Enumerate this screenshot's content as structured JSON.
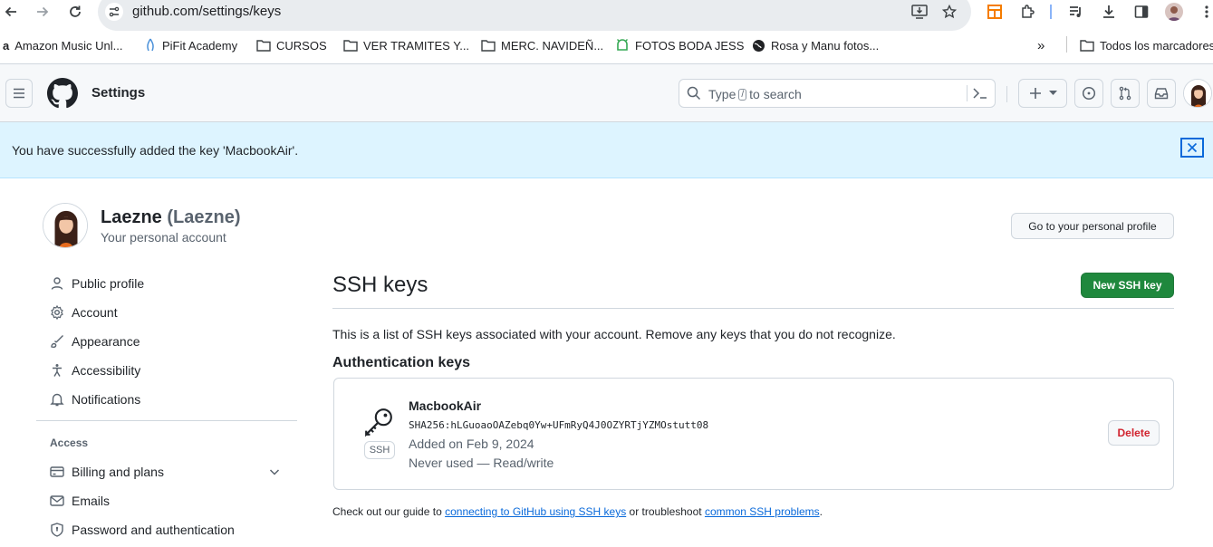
{
  "browser": {
    "url": "github.com/settings/keys",
    "bookmarks": [
      {
        "label": "Amazon Music Unl...",
        "icon": "amazon-icon"
      },
      {
        "label": "PiFit Academy",
        "icon": "pifit-icon"
      },
      {
        "label": "CURSOS",
        "icon": "folder-icon"
      },
      {
        "label": "VER TRAMITES Y...",
        "icon": "folder-icon"
      },
      {
        "label": "MERC. NAVIDEÑ...",
        "icon": "folder-icon"
      },
      {
        "label": "FOTOS BODA JESS",
        "icon": "android-icon"
      },
      {
        "label": "Rosa y Manu fotos...",
        "icon": "globe-icon"
      }
    ],
    "overflow_label": "»",
    "all_bookmarks_label": "Todos los marcadores"
  },
  "header": {
    "title": "Settings",
    "search_prefix": "Type",
    "search_key": "/",
    "search_suffix": "to search"
  },
  "flash": {
    "message": "You have successfully added the key 'MacbookAir'."
  },
  "profile": {
    "name": "Laezne",
    "login": "(Laezne)",
    "subtitle": "Your personal account",
    "profile_button": "Go to your personal profile"
  },
  "sidebar": {
    "items": [
      {
        "label": "Public profile",
        "icon": "person-icon"
      },
      {
        "label": "Account",
        "icon": "gear-icon"
      },
      {
        "label": "Appearance",
        "icon": "paintbrush-icon"
      },
      {
        "label": "Accessibility",
        "icon": "accessibility-icon"
      },
      {
        "label": "Notifications",
        "icon": "bell-icon"
      }
    ],
    "access_heading": "Access",
    "access_items": [
      {
        "label": "Billing and plans",
        "icon": "credit-card-icon"
      },
      {
        "label": "Emails",
        "icon": "mail-icon"
      },
      {
        "label": "Password and authentication",
        "icon": "shield-lock-icon"
      }
    ]
  },
  "main": {
    "title": "SSH keys",
    "new_key_button": "New SSH key",
    "description": "This is a list of SSH keys associated with your account. Remove any keys that you do not recognize.",
    "auth_heading": "Authentication keys",
    "key": {
      "type_badge": "SSH",
      "name": "MacbookAir",
      "fingerprint": "SHA256:hLGuoaoOAZebq0Yw+UFmRyQ4J0OZYRTjYZMOstutt08",
      "added": "Added on Feb 9, 2024",
      "usage": "Never used — Read/write",
      "delete_button": "Delete"
    },
    "footer": {
      "prefix": "Check out our guide to",
      "link1": "connecting to GitHub using SSH keys",
      "middle": "or troubleshoot",
      "link2": "common SSH problems",
      "suffix": "."
    }
  },
  "colors": {
    "primary_button": "#1f883d",
    "danger": "#d1242f",
    "link": "#0969da",
    "flash_bg": "#ddf4ff"
  }
}
